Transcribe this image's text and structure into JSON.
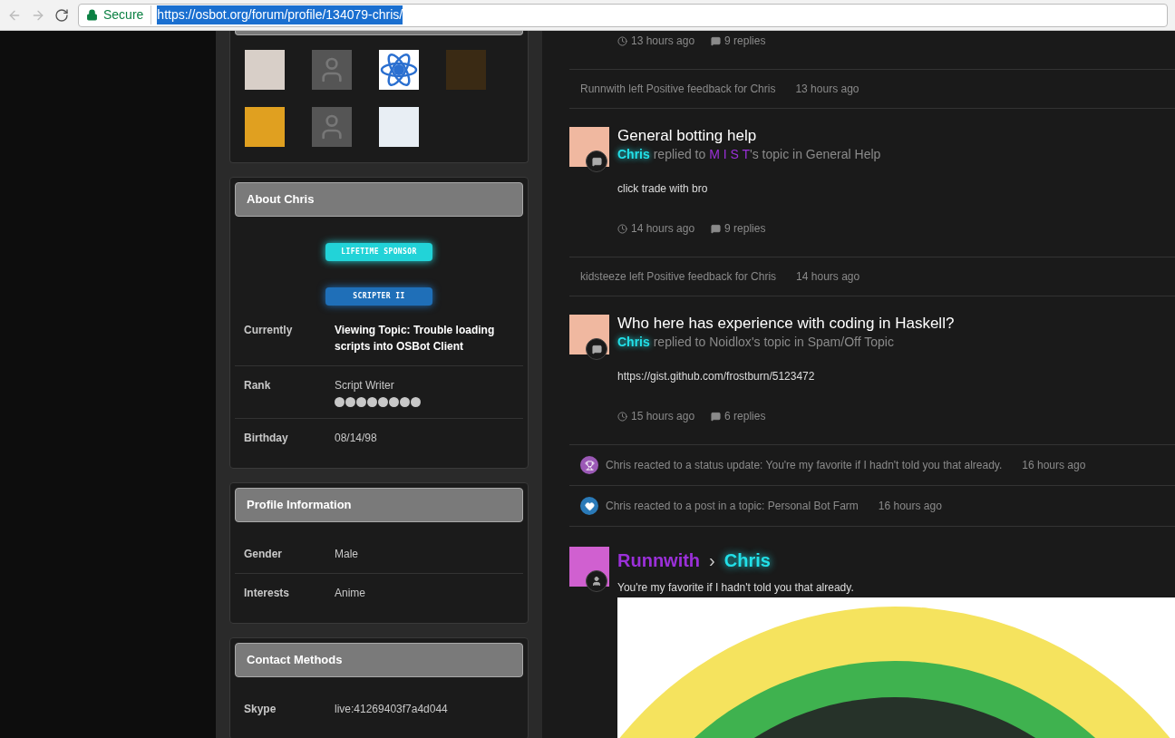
{
  "browser": {
    "secure_label": "Secure",
    "url": "https://osbot.org/forum/profile/134079-chris/"
  },
  "followers": [
    {
      "kind": "photo",
      "color": "#d8cfc8"
    },
    {
      "kind": "default"
    },
    {
      "kind": "logo"
    },
    {
      "kind": "photo",
      "color": "#3a2a14"
    },
    {
      "kind": "photo",
      "color": "#e0a020"
    },
    {
      "kind": "default"
    },
    {
      "kind": "photo",
      "color": "#e8eef4"
    }
  ],
  "about": {
    "title": "About Chris",
    "badges": [
      {
        "label": "LIFETIME SPONSOR",
        "kind": "sponsor"
      },
      {
        "label": "SCRIPTER II",
        "kind": "scripter"
      }
    ],
    "fields": [
      {
        "label": "Currently",
        "value": "Viewing Topic: Trouble loading scripts into OSBot Client",
        "bold": true
      },
      {
        "label": "Rank",
        "value": "Script Writer",
        "stars": 8,
        "bold": false
      },
      {
        "label": "Birthday",
        "value": "08/14/98",
        "bold": false
      }
    ]
  },
  "profile_info": {
    "title": "Profile Information",
    "fields": [
      {
        "label": "Gender",
        "value": "Male"
      },
      {
        "label": "Interests",
        "value": "Anime"
      }
    ]
  },
  "contact": {
    "title": "Contact Methods",
    "fields": [
      {
        "label": "Skype",
        "value": "live:41269403f7a4d044"
      }
    ]
  },
  "feed": [
    {
      "kind": "post",
      "time": "13 hours ago",
      "replies": "9 replies"
    },
    {
      "kind": "activity",
      "text": "Runnwith left Positive feedback for Chris",
      "time": "13 hours ago"
    },
    {
      "kind": "post",
      "title": "General botting help",
      "author": "Chris",
      "action": " replied to ",
      "owner": "M I S T",
      "owner_highlighted": true,
      "suffix": "'s topic in General Help",
      "body": "click trade with bro",
      "time": "14 hours ago",
      "replies": "9 replies"
    },
    {
      "kind": "activity",
      "text": "kidsteeze left Positive feedback for Chris",
      "time": "14 hours ago"
    },
    {
      "kind": "post",
      "title": "Who here has experience with coding in Haskell?",
      "author": "Chris",
      "action": " replied to ",
      "owner": "Noidlox",
      "owner_highlighted": false,
      "suffix": "'s topic in Spam/Off Topic",
      "body": "https://gist.github.com/frostburn/5123472",
      "time": "15 hours ago",
      "replies": "6 replies"
    },
    {
      "kind": "status_reaction",
      "text": "Chris reacted to a status update: You're my favorite if I hadn't told you that already.",
      "time": "16 hours ago"
    },
    {
      "kind": "post_reaction",
      "text": "Chris reacted to a post in a topic: Personal Bot Farm",
      "time": "16 hours ago"
    },
    {
      "kind": "status",
      "from": "Runnwith",
      "to": "Chris",
      "separator": "›",
      "text": "You're my favorite if I hadn't told you that already."
    }
  ]
}
